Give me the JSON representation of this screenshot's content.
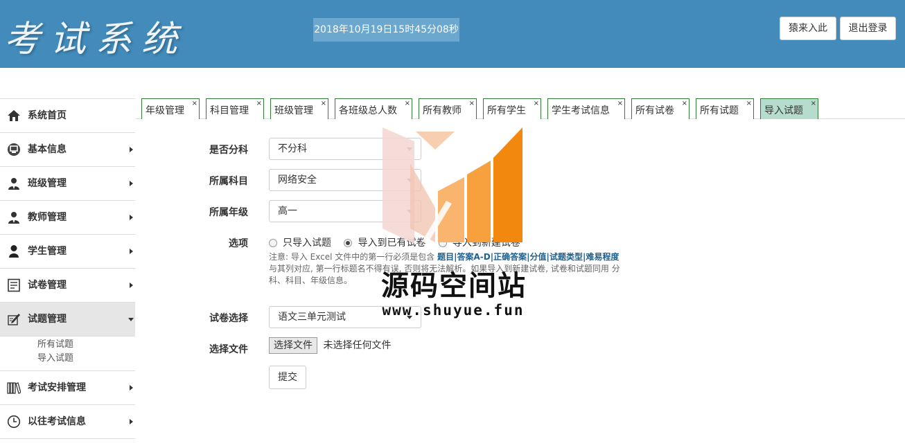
{
  "header": {
    "logo_text": "考试系统",
    "datetime": "2018年10月19日15时45分08秒",
    "user_button": "猿来入此",
    "logout_button": "退出登录",
    "bg_color": "#428bba"
  },
  "sidebar": {
    "items": [
      {
        "label": "系统首页",
        "icon": "home-icon"
      },
      {
        "label": "基本信息",
        "icon": "monitor-icon"
      },
      {
        "label": "班级管理",
        "icon": "user-tie-icon"
      },
      {
        "label": "教师管理",
        "icon": "user-tie-icon"
      },
      {
        "label": "学生管理",
        "icon": "user-icon"
      },
      {
        "label": "试卷管理",
        "icon": "document-icon"
      },
      {
        "label": "试题管理",
        "icon": "edit-icon"
      },
      {
        "label": "考试安排管理",
        "icon": "books-icon"
      },
      {
        "label": "以往考试信息",
        "icon": "clock-icon"
      }
    ],
    "submenu": [
      "所有试题",
      "导入试题"
    ]
  },
  "tabs": [
    "年级管理",
    "科目管理",
    "班级管理",
    "各班级总人数",
    "所有教师",
    "所有学生",
    "学生考试信息",
    "所有试卷",
    "所有试题",
    "导入试题"
  ],
  "tab_close": "×",
  "form": {
    "divide_label": "是否分科",
    "divide_value": "不分科",
    "subject_label": "所属科目",
    "subject_value": "网络安全",
    "grade_label": "所属年级",
    "grade_value": "高一",
    "options_label": "选项",
    "radio1": "只导入试题",
    "radio2": "导入到已有试卷",
    "radio3": "导入到新建试卷",
    "note_prefix": "注意: 导入 Excel 文件中的第一行必须是包含 ",
    "note_fields": [
      "题目",
      "答案A-D",
      "正确答案",
      "分值",
      "试题类型",
      "难易程度"
    ],
    "note_sep": "|",
    "note_suffix": " 与其列对应, 第一行标题名不得有误, 否则将无法解析。如果导入到新建试卷, 试卷和试题同用 分科、科目、年级信息。",
    "paper_label": "试卷选择",
    "paper_value": "语文三单元测试",
    "file_label": "选择文件",
    "file_button": "选择文件",
    "file_status": "未选择任何文件",
    "submit": "提交"
  },
  "watermark": {
    "title": "源码空间站",
    "url": "www.shuyue.fun"
  }
}
